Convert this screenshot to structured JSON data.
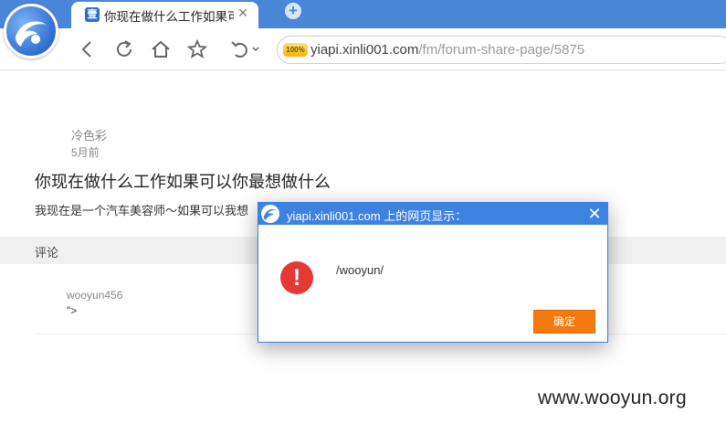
{
  "browser": {
    "tab": {
      "favicon_glyph": "壹",
      "title": "你现在做什么工作如果可以你最想做什么",
      "close_glyph": "✕"
    },
    "new_tab_glyph": "+",
    "address": {
      "badge": "100%",
      "host": "yiapi.xinli001.com",
      "path": "/fm/forum-share-page/5875"
    },
    "toolbar_icons": [
      "back-icon",
      "refresh-icon",
      "home-icon",
      "star-icon",
      "undo-icon"
    ]
  },
  "post": {
    "author": "冷色彩",
    "time": "5月前",
    "title": "你现在做什么工作如果可以你最想做什么",
    "body": "我现在是一个汽车美容师～如果可以我想"
  },
  "comments": {
    "label": "评论",
    "items": [
      {
        "author": "wooyun456",
        "text": "\">"
      }
    ]
  },
  "dialog": {
    "title": "yiapi.xinli001.com 上的网页显示：",
    "close_glyph": "✕",
    "icon_glyph": "!",
    "message": "/wooyun/",
    "ok_label": "确定"
  },
  "watermark": "www.wooyun.org",
  "colors": {
    "chrome_blue": "#4a86d8",
    "dialog_blue": "#3d82e0",
    "ok_orange": "#f47a0f",
    "error_red": "#e53935"
  }
}
